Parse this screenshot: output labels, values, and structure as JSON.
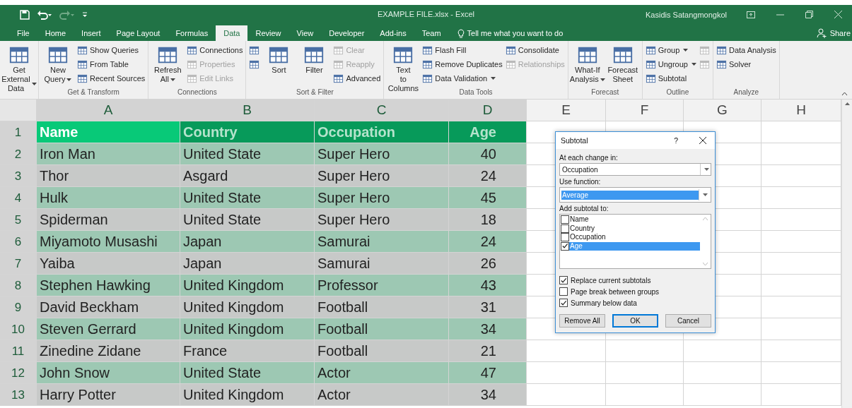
{
  "window": {
    "title": "EXAMPLE FILE.xlsx  -  Excel",
    "user": "Kasidis Satangmongkol"
  },
  "quick_access": [
    {
      "kind": "save",
      "disabled": false
    },
    {
      "kind": "undo",
      "disabled": false
    },
    {
      "kind": "redo",
      "disabled": true
    },
    {
      "kind": "customize",
      "disabled": false
    }
  ],
  "tabs": [
    {
      "label": "File",
      "selected": false
    },
    {
      "label": "Home",
      "selected": false
    },
    {
      "label": "Insert",
      "selected": false
    },
    {
      "label": "Page Layout",
      "selected": false
    },
    {
      "label": "Formulas",
      "selected": false
    },
    {
      "label": "Data",
      "selected": true
    },
    {
      "label": "Review",
      "selected": false
    },
    {
      "label": "View",
      "selected": false
    },
    {
      "label": "Developer",
      "selected": false
    },
    {
      "label": "Add-ins",
      "selected": false
    },
    {
      "label": "Team",
      "selected": false
    }
  ],
  "tell_me": {
    "placeholder": "Tell me what you want to do"
  },
  "share": {
    "label": "Share"
  },
  "ribbon": [
    {
      "columns": [
        {
          "kind": "large",
          "items": [
            {
              "label": "Get External Data",
              "dropdown": true,
              "disabled": false
            }
          ]
        }
      ]
    },
    {
      "label": "Get & Transform",
      "columns": [
        {
          "kind": "large",
          "items": [
            {
              "label": "New Query",
              "dropdown": true,
              "disabled": false
            }
          ]
        },
        {
          "kind": "small",
          "items": [
            {
              "label": "Show Queries",
              "dropdown": false,
              "disabled": false
            },
            {
              "label": "From Table",
              "dropdown": false,
              "disabled": false
            },
            {
              "label": "Recent Sources",
              "dropdown": false,
              "disabled": false
            }
          ]
        }
      ]
    },
    {
      "label": "Connections",
      "columns": [
        {
          "kind": "large",
          "items": [
            {
              "label": "Refresh All",
              "dropdown": true,
              "disabled": false
            }
          ]
        },
        {
          "kind": "small",
          "items": [
            {
              "label": "Connections",
              "dropdown": false,
              "disabled": false
            },
            {
              "label": "Properties",
              "dropdown": false,
              "disabled": true
            },
            {
              "label": "Edit Links",
              "dropdown": false,
              "disabled": true
            }
          ]
        }
      ]
    },
    {
      "label": "Sort & Filter",
      "columns": [
        {
          "kind": "small",
          "items": [
            {
              "dropdown": false,
              "disabled": false
            },
            {
              "dropdown": false,
              "disabled": false
            }
          ]
        },
        {
          "kind": "large",
          "items": [
            {
              "label": "Sort",
              "dropdown": false,
              "disabled": false
            }
          ]
        },
        {
          "kind": "large",
          "items": [
            {
              "label": "Filter",
              "dropdown": false,
              "disabled": false
            }
          ]
        },
        {
          "kind": "small",
          "items": [
            {
              "label": "Clear",
              "dropdown": false,
              "disabled": true
            },
            {
              "label": "Reapply",
              "dropdown": false,
              "disabled": true
            },
            {
              "label": "Advanced",
              "dropdown": false,
              "disabled": false
            }
          ]
        }
      ]
    },
    {
      "label": "Data Tools",
      "columns": [
        {
          "kind": "large",
          "items": [
            {
              "label": "Text to Columns",
              "dropdown": false,
              "disabled": false
            }
          ]
        },
        {
          "kind": "small",
          "items": [
            {
              "label": "Flash Fill",
              "dropdown": false,
              "disabled": false
            },
            {
              "label": "Remove Duplicates",
              "dropdown": false,
              "disabled": false
            },
            {
              "label": "Data Validation",
              "dropdown": true,
              "disabled": false
            }
          ]
        },
        {
          "kind": "small",
          "items": [
            {
              "label": "Consolidate",
              "dropdown": false,
              "disabled": false
            },
            {
              "label": "Relationships",
              "dropdown": false,
              "disabled": true
            }
          ]
        }
      ]
    },
    {
      "label": "Forecast",
      "columns": [
        {
          "kind": "large",
          "items": [
            {
              "label": "What-If Analysis",
              "dropdown": true,
              "disabled": false
            }
          ]
        },
        {
          "kind": "large",
          "items": [
            {
              "label": "Forecast Sheet",
              "dropdown": false,
              "disabled": false
            }
          ]
        }
      ]
    },
    {
      "label": "Outline",
      "columns": [
        {
          "kind": "small",
          "items": [
            {
              "label": "Group",
              "dropdown": true,
              "disabled": false
            },
            {
              "label": "Ungroup",
              "dropdown": true,
              "disabled": false
            },
            {
              "label": "Subtotal",
              "dropdown": false,
              "disabled": false
            }
          ]
        },
        {
          "kind": "small",
          "items": [
            {
              "dropdown": false,
              "disabled": true
            },
            {
              "dropdown": false,
              "disabled": true
            }
          ]
        }
      ]
    },
    {
      "label": "Analyze",
      "columns": [
        {
          "kind": "small",
          "items": [
            {
              "label": "Data Analysis",
              "dropdown": false,
              "disabled": false
            },
            {
              "label": "Solver",
              "dropdown": false,
              "disabled": false
            }
          ]
        }
      ]
    }
  ],
  "sheet": {
    "columns": [
      {
        "label": "A",
        "selected": true
      },
      {
        "label": "B",
        "selected": true
      },
      {
        "label": "C",
        "selected": true
      },
      {
        "label": "D",
        "selected": true
      },
      {
        "label": "E",
        "selected": false
      },
      {
        "label": "F",
        "selected": false
      },
      {
        "label": "G",
        "selected": false
      },
      {
        "label": "H",
        "selected": false
      }
    ],
    "rows": [
      {
        "number": "1",
        "kind": "header",
        "cells": [
          {
            "text": "Name",
            "active": true
          },
          {
            "text": "Country",
            "active": false
          },
          {
            "text": "Occupation",
            "active": false
          },
          {
            "text": "Age",
            "active": false
          }
        ]
      },
      {
        "number": "2",
        "kind": "data",
        "cells": [
          {
            "text": "Iron Man",
            "active": false
          },
          {
            "text": "United State",
            "active": false
          },
          {
            "text": "Super Hero",
            "active": false
          },
          {
            "text": "40",
            "active": false
          }
        ]
      },
      {
        "number": "3",
        "kind": "data",
        "cells": [
          {
            "text": "Thor",
            "active": false
          },
          {
            "text": "Asgard",
            "active": false
          },
          {
            "text": "Super Hero",
            "active": false
          },
          {
            "text": "24",
            "active": false
          }
        ]
      },
      {
        "number": "4",
        "kind": "data",
        "cells": [
          {
            "text": "Hulk",
            "active": false
          },
          {
            "text": "United State",
            "active": false
          },
          {
            "text": "Super Hero",
            "active": false
          },
          {
            "text": "45",
            "active": false
          }
        ]
      },
      {
        "number": "5",
        "kind": "data",
        "cells": [
          {
            "text": "Spiderman",
            "active": false
          },
          {
            "text": "United State",
            "active": false
          },
          {
            "text": "Super Hero",
            "active": false
          },
          {
            "text": "18",
            "active": false
          }
        ]
      },
      {
        "number": "6",
        "kind": "data",
        "cells": [
          {
            "text": "Miyamoto Musashi",
            "active": false
          },
          {
            "text": "Japan",
            "active": false
          },
          {
            "text": "Samurai",
            "active": false
          },
          {
            "text": "24",
            "active": false
          }
        ]
      },
      {
        "number": "7",
        "kind": "data",
        "cells": [
          {
            "text": "Yaiba",
            "active": false
          },
          {
            "text": "Japan",
            "active": false
          },
          {
            "text": "Samurai",
            "active": false
          },
          {
            "text": "26",
            "active": false
          }
        ]
      },
      {
        "number": "8",
        "kind": "data",
        "cells": [
          {
            "text": "Stephen Hawking",
            "active": false
          },
          {
            "text": "United Kingdom",
            "active": false
          },
          {
            "text": "Professor",
            "active": false
          },
          {
            "text": "43",
            "active": false
          }
        ]
      },
      {
        "number": "9",
        "kind": "data",
        "cells": [
          {
            "text": "David Beckham",
            "active": false
          },
          {
            "text": "United Kingdom",
            "active": false
          },
          {
            "text": "Football",
            "active": false
          },
          {
            "text": "31",
            "active": false
          }
        ]
      },
      {
        "number": "10",
        "kind": "data",
        "cells": [
          {
            "text": "Steven Gerrard",
            "active": false
          },
          {
            "text": "United Kingdom",
            "active": false
          },
          {
            "text": "Football",
            "active": false
          },
          {
            "text": "34",
            "active": false
          }
        ]
      },
      {
        "number": "11",
        "kind": "data",
        "cells": [
          {
            "text": "Zinedine Zidane",
            "active": false
          },
          {
            "text": "France",
            "active": false
          },
          {
            "text": "Football",
            "active": false
          },
          {
            "text": "21",
            "active": false
          }
        ]
      },
      {
        "number": "12",
        "kind": "data",
        "cells": [
          {
            "text": "John Snow",
            "active": false
          },
          {
            "text": "United State",
            "active": false
          },
          {
            "text": "Actor",
            "active": false
          },
          {
            "text": "47",
            "active": false
          }
        ]
      },
      {
        "number": "13",
        "kind": "data",
        "cells": [
          {
            "text": "Harry Potter",
            "active": false
          },
          {
            "text": "United Kingdom",
            "active": false
          },
          {
            "text": "Actor",
            "active": false
          },
          {
            "text": "34",
            "active": false
          }
        ]
      }
    ]
  },
  "dialog": {
    "title": "Subtotal",
    "help": "?",
    "change_label": "At each change in:",
    "change_value": "Occupation",
    "function_label": "Use function:",
    "function_value": "Average",
    "function_focused": true,
    "list_label": "Add subtotal to:",
    "list": [
      {
        "label": "Name",
        "checked": false,
        "selected": false
      },
      {
        "label": "Country",
        "checked": false,
        "selected": false
      },
      {
        "label": "Occupation",
        "checked": false,
        "selected": false
      },
      {
        "label": "Age",
        "checked": true,
        "selected": true
      }
    ],
    "options": [
      {
        "label": "Replace current subtotals",
        "checked": true
      },
      {
        "label": "Page break between groups",
        "checked": false
      },
      {
        "label": "Summary below data",
        "checked": true
      }
    ],
    "buttons": [
      {
        "label": "Remove All",
        "default": false
      },
      {
        "label": "OK",
        "default": true
      },
      {
        "label": "Cancel",
        "default": false
      }
    ]
  }
}
